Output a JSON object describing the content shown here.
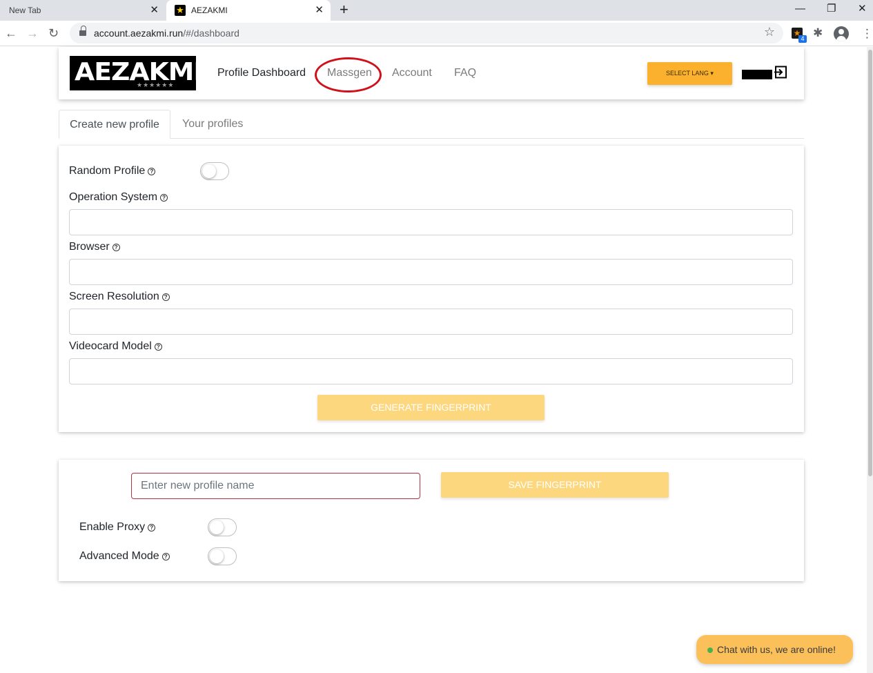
{
  "browser": {
    "tabs": [
      {
        "title": "New Tab"
      },
      {
        "title": "AEZAKMI"
      }
    ],
    "url_host": "account.aezakmi.run",
    "url_path": "/#/dashboard",
    "extension_badge": "4"
  },
  "navbar": {
    "logo_text": "AEZAKMI",
    "logo_stars": "★★★★★★",
    "links": {
      "dashboard": "Profile Dashboard",
      "massgen": "Massgen",
      "account": "Account",
      "faq": "FAQ"
    },
    "lang_button": "SELECT LANG ▾"
  },
  "profile_tabs": {
    "create": "Create new profile",
    "yours": "Your profiles"
  },
  "form": {
    "random_profile": "Random Profile",
    "operation_system": "Operation System",
    "browser": "Browser",
    "screen_resolution": "Screen Resolution",
    "videocard_model": "Videocard Model",
    "generate_button": "GENERATE FINGERPRINT",
    "values": {
      "operation_system": "",
      "browser": "",
      "screen_resolution": "",
      "videocard_model": ""
    },
    "random_profile_on": false
  },
  "save": {
    "name_placeholder": "Enter new profile name",
    "save_button": "SAVE FINGERPRINT",
    "enable_proxy": "Enable Proxy",
    "advanced_mode": "Advanced Mode",
    "enable_proxy_on": false,
    "advanced_mode_on": false
  },
  "chat": {
    "text": "Chat with us, we are online!"
  },
  "colors": {
    "accent": "#fbb12e",
    "button_disabled": "#fdd77e",
    "highlight_circle": "#d0101a"
  }
}
